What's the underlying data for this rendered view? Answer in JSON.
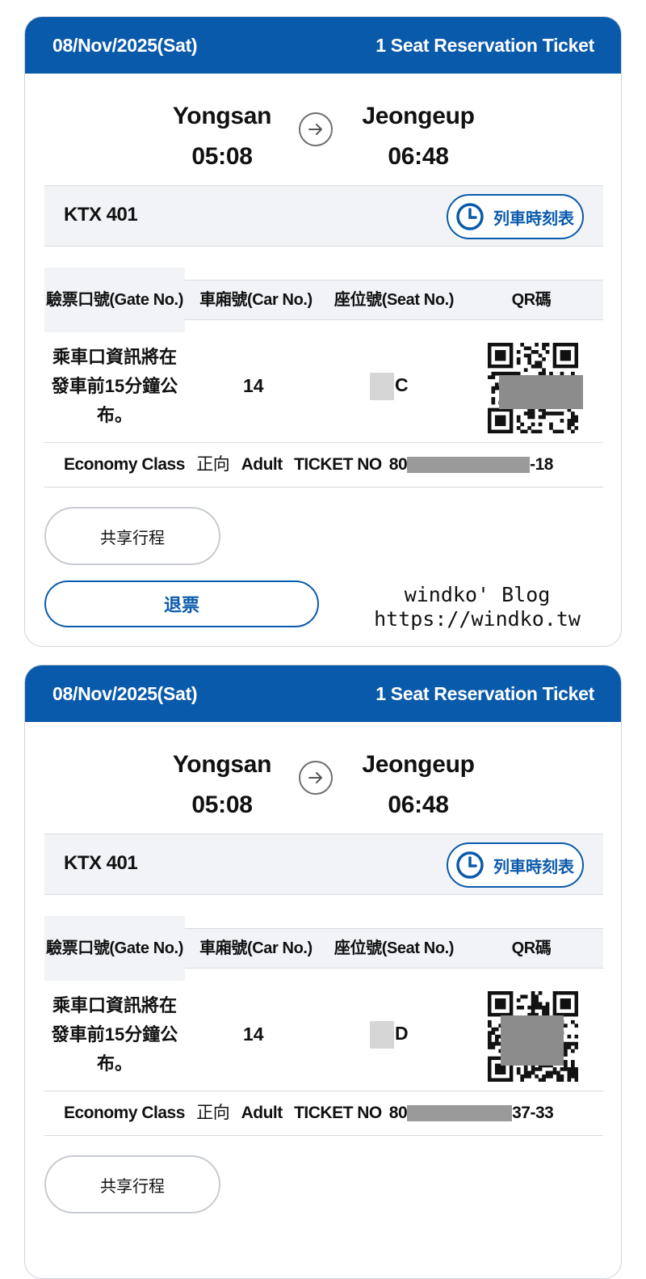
{
  "tickets": [
    {
      "date": "08/Nov/2025(Sat)",
      "ticket_type": "1 Seat Reservation Ticket",
      "from_station": "Yongsan",
      "from_time": "05:08",
      "to_station": "Jeongeup",
      "to_time": "06:48",
      "train_no": "KTX 401",
      "timetable_label": "列車時刻表",
      "gate_header": "驗票口號(Gate No.)",
      "car_header": "車廂號(Car No.)",
      "seat_header": "座位號(Seat No.)",
      "qr_header": "QR碼",
      "gate_info": "乘車口資訊將在發車前15分鐘公布。",
      "car_no": "14",
      "seat_visible": "C",
      "class_label": "Economy Class",
      "direction": "正向",
      "passenger": "Adult",
      "ticket_no_label": "TICKET NO",
      "ticket_no_prefix": "80",
      "ticket_no_suffix": "-18",
      "share_label": "共享行程",
      "refund_label": "退票"
    },
    {
      "date": "08/Nov/2025(Sat)",
      "ticket_type": "1 Seat Reservation Ticket",
      "from_station": "Yongsan",
      "from_time": "05:08",
      "to_station": "Jeongeup",
      "to_time": "06:48",
      "train_no": "KTX 401",
      "timetable_label": "列車時刻表",
      "gate_header": "驗票口號(Gate No.)",
      "car_header": "車廂號(Car No.)",
      "seat_header": "座位號(Seat No.)",
      "qr_header": "QR碼",
      "gate_info": "乘車口資訊將在發車前15分鐘公布。",
      "car_no": "14",
      "seat_visible": "D",
      "class_label": "Economy Class",
      "direction": "正向",
      "passenger": "Adult",
      "ticket_no_label": "TICKET NO",
      "ticket_no_prefix": "80",
      "ticket_no_suffix": "37-33",
      "share_label": "共享行程"
    }
  ],
  "watermark": {
    "line1": "windko' Blog",
    "line2": "https://windko.tw"
  },
  "colors": {
    "brand_blue": "#0a5aab",
    "panel_gray": "#f1f3f6",
    "divider": "#d9dce2"
  },
  "icons": {
    "arrow": "arrow-right-circle-icon",
    "clock": "clock-icon",
    "qr": "qr-code-icon"
  }
}
